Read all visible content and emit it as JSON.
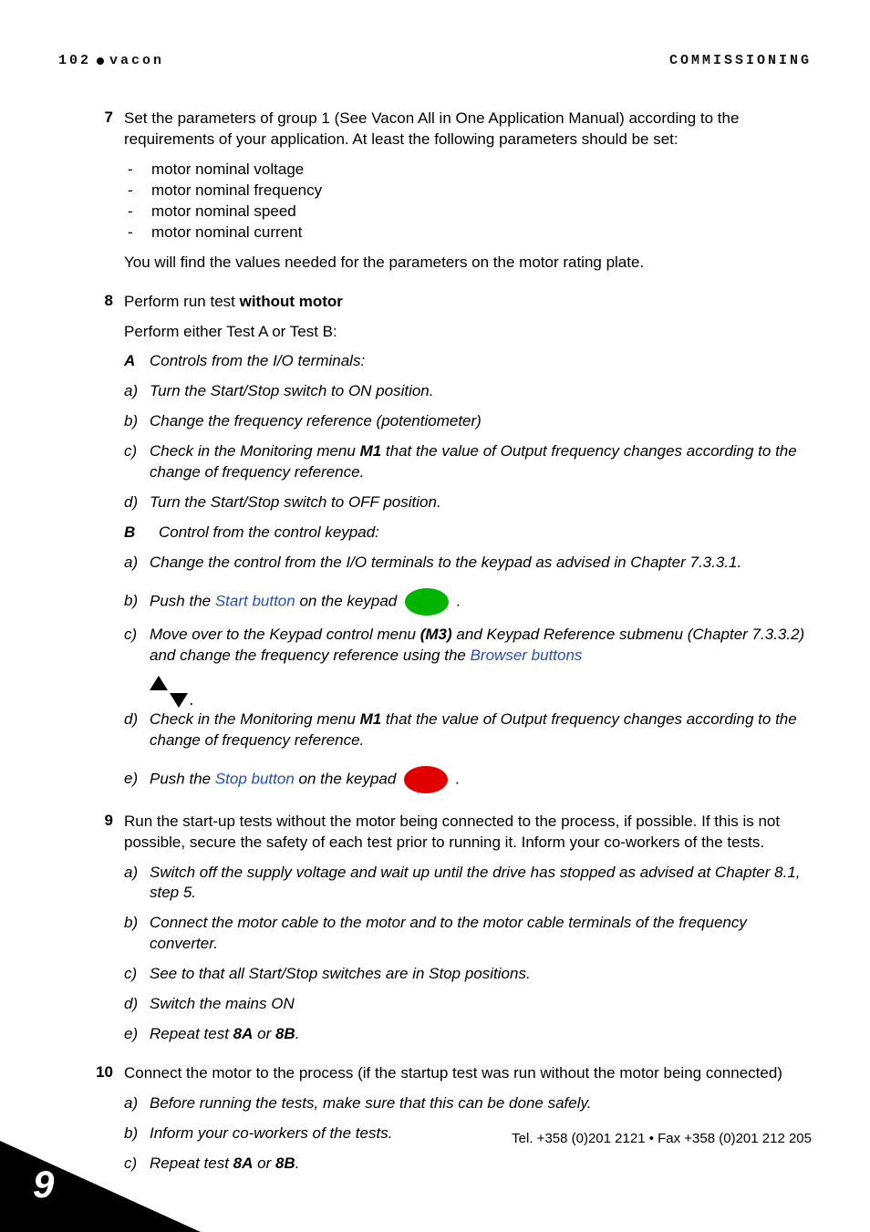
{
  "header": {
    "page_number": "102",
    "brand": "vacon",
    "section": "COMMISSIONING"
  },
  "steps": {
    "s7": {
      "num": "7",
      "intro": "Set the parameters of group 1 (See Vacon All in One Application Manual) according to the requirements of your application. At least the following parameters should be set:",
      "bullets": {
        "b1": "motor nominal voltage",
        "b2": "motor nominal frequency",
        "b3": "motor nominal speed",
        "b4": "motor nominal current"
      },
      "outro": "You will find the values needed for the parameters on the motor rating plate."
    },
    "s8": {
      "num": "8",
      "intro_pre": "Perform run test ",
      "intro_bold": "without motor",
      "either": "Perform either Test A or Test B:",
      "A_label": "A",
      "A_title": " Controls from the I/O terminals:",
      "A": {
        "a": {
          "lab": "a)",
          "txt": "Turn the Start/Stop switch to ON position."
        },
        "b": {
          "lab": "b)",
          "txt": "Change the frequency reference (potentiometer)"
        },
        "c": {
          "lab": "c)",
          "pre": "Check in the Monitoring menu ",
          "em": "M1",
          "post": " that the value of Output frequency changes according to the change of frequency reference."
        },
        "d": {
          "lab": "d)",
          "txt": "Turn the Start/Stop switch to OFF position."
        }
      },
      "B_label": "B",
      "B_title": "Control from the control keypad:",
      "B": {
        "a": {
          "lab": "a)",
          "txt": "Change the control from the I/O terminals to the keypad as advised in Chapter 7.3.3.1."
        },
        "b": {
          "lab": "b)",
          "pre": "Push the ",
          "link": "Start button",
          "post": " on the keypad ",
          "tail": " ."
        },
        "c": {
          "lab": "c)",
          "pre": "Move over to the Keypad control menu ",
          "em": "(M3)",
          "mid": " and Keypad Reference submenu (Chapter 7.3.3.2) and change the frequency reference using the ",
          "link": "Browser buttons"
        },
        "d": {
          "lab": "d)",
          "pre": "Check in the Monitoring menu ",
          "em": "M1",
          "post": " that the value of Output frequency changes according to the change of frequency reference."
        },
        "e": {
          "lab": "e)",
          "pre": "Push the ",
          "link": "Stop button",
          "post": " on the keypad ",
          "tail": " ."
        }
      }
    },
    "s9": {
      "num": "9",
      "intro": "Run the start-up tests without the motor being connected to the process, if possible. If this is not possible, secure the safety of each test prior to running it. Inform your co-workers of the tests.",
      "items": {
        "a": {
          "lab": "a)",
          "txt": "Switch off the supply voltage and wait up until the drive has stopped as advised at Chapter 8.1, step 5."
        },
        "b": {
          "lab": "b)",
          "txt": "Connect the motor cable to the motor and to the motor cable terminals of the frequency converter."
        },
        "c": {
          "lab": "c)",
          "txt": "See to that all Start/Stop switches are in Stop positions."
        },
        "d": {
          "lab": "d)",
          "txt": "Switch the mains ON"
        },
        "e": {
          "lab": "e)",
          "pre": "Repeat test ",
          "em1": "8A",
          "mid": " or ",
          "em2": "8B",
          "post": "."
        }
      }
    },
    "s10": {
      "num": "10",
      "intro": "Connect the motor to the process (if the startup test was run without the motor being connected)",
      "items": {
        "a": {
          "lab": "a)",
          "txt": "Before running the tests, make sure that this can be done safely."
        },
        "b": {
          "lab": "b)",
          "txt": "Inform your co-workers of the tests."
        },
        "c": {
          "lab": "c)",
          "pre": "Repeat test ",
          "em1": "8A",
          "mid": " or ",
          "em2": "8B",
          "post": "."
        }
      }
    }
  },
  "footer": {
    "contact": "Tel. +358 (0)201 2121 • Fax +358 (0)201 212 205",
    "chapter": "9"
  }
}
